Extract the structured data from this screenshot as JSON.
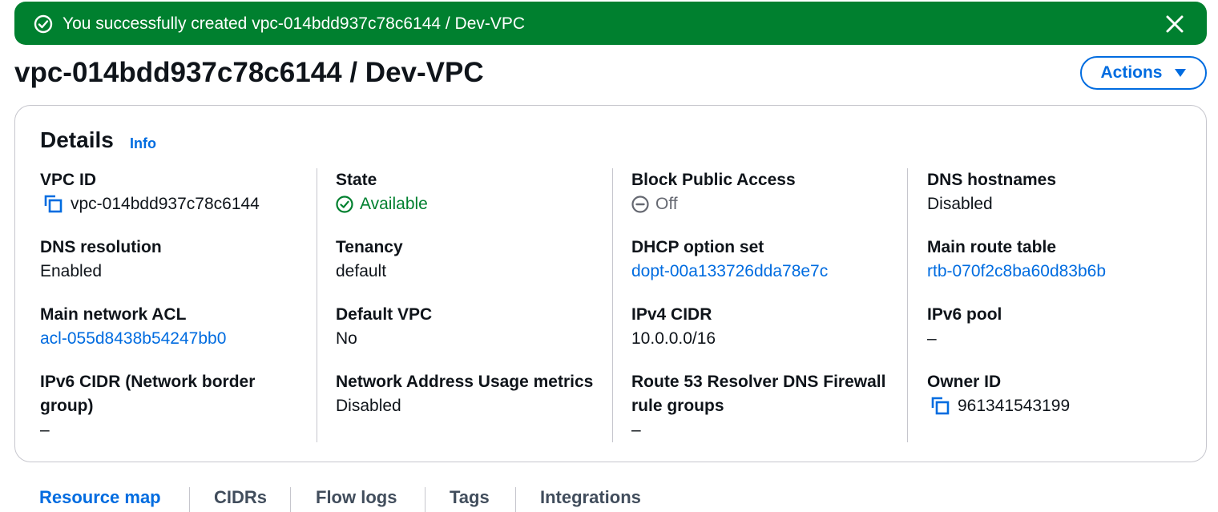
{
  "banner": {
    "message": "You successfully created vpc-014bdd937c78c6144 / Dev-VPC",
    "color": "#00802f"
  },
  "header": {
    "title": "vpc-014bdd937c78c6144 / Dev-VPC",
    "actions_label": "Actions"
  },
  "details": {
    "title": "Details",
    "info_label": "Info",
    "columns": [
      [
        {
          "label": "VPC ID",
          "value": "vpc-014bdd937c78c6144"
        },
        {
          "label": "DNS resolution",
          "value": "Enabled"
        },
        {
          "label": "Main network ACL",
          "value": "acl-055d8438b54247bb0"
        },
        {
          "label": "IPv6 CIDR (Network border group)",
          "value": "–"
        }
      ],
      [
        {
          "label": "State",
          "value": "Available"
        },
        {
          "label": "Tenancy",
          "value": "default"
        },
        {
          "label": "Default VPC",
          "value": "No"
        },
        {
          "label": "Network Address Usage metrics",
          "value": "Disabled"
        }
      ],
      [
        {
          "label": "Block Public Access",
          "value": "Off"
        },
        {
          "label": "DHCP option set",
          "value": "dopt-00a133726dda78e7c"
        },
        {
          "label": "IPv4 CIDR",
          "value": "10.0.0.0/16"
        },
        {
          "label": "Route 53 Resolver DNS Firewall rule groups",
          "value": "–"
        }
      ],
      [
        {
          "label": "DNS hostnames",
          "value": "Disabled"
        },
        {
          "label": "Main route table",
          "value": "rtb-070f2c8ba60d83b6b"
        },
        {
          "label": "IPv6 pool",
          "value": "–"
        },
        {
          "label": "Owner ID",
          "value": "961341543199"
        }
      ]
    ]
  },
  "tabs": [
    {
      "label": "Resource map",
      "active": true
    },
    {
      "label": "CIDRs"
    },
    {
      "label": "Flow logs"
    },
    {
      "label": "Tags"
    },
    {
      "label": "Integrations"
    }
  ],
  "colors": {
    "accent": "#006ce0",
    "success": "#00802f",
    "border": "#c6c6cd"
  },
  "icons": {
    "banner": "check-circle-icon",
    "close": "close-icon",
    "copy": "copy-icon",
    "state": "check-circle-icon",
    "block_public_access": "minus-circle-icon",
    "actions": "caret-down-icon"
  }
}
